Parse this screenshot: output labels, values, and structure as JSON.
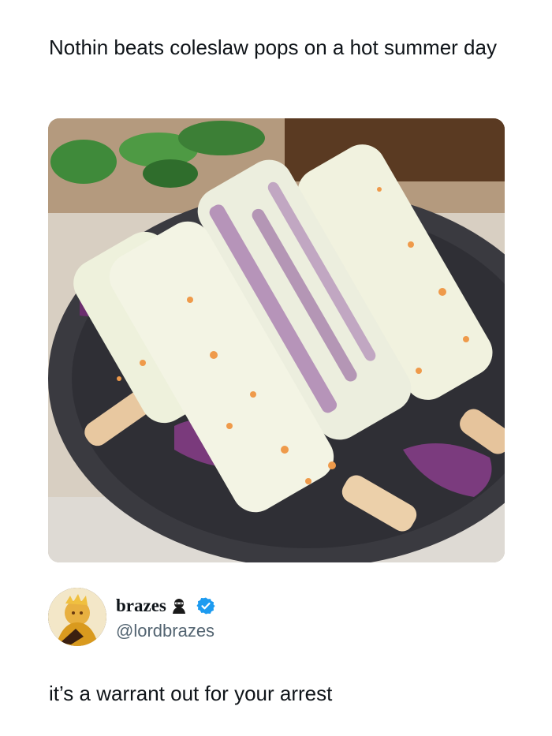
{
  "post": {
    "text": "Nothin beats coleslaw pops on a hot summer day",
    "image_icon": "coleslaw-popsicles-photo"
  },
  "reply": {
    "display_name": "brazes",
    "handle": "@lordbrazes",
    "text": "it’s a warrant out for your arrest",
    "avatar_icon": "profile-avatar",
    "badge_icon": "verified-badge-icon",
    "emoji_icon": "ninja-icon"
  },
  "colors": {
    "verified": "#1d9bf0",
    "text": "#0f1419",
    "handle": "#536471"
  }
}
